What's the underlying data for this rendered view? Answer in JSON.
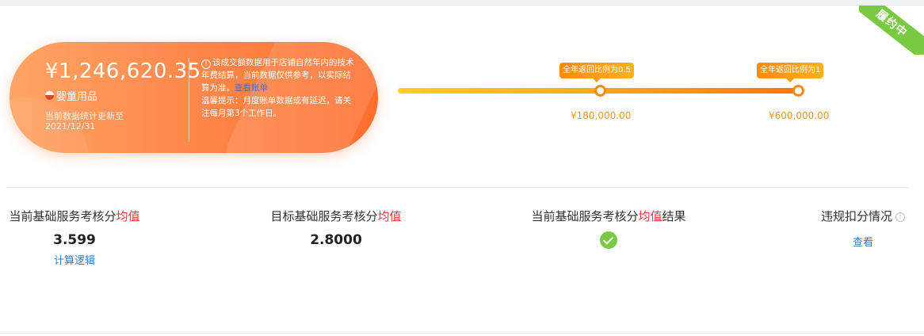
{
  "status_ribbon": {
    "label": "履约中",
    "color": "#7ac943"
  },
  "summary_card": {
    "amount": "¥1,246,620.35",
    "category": "婴童用品",
    "update_label": "当前数据统计更新至",
    "update_date": "2021/12/31",
    "notice_text_1": "该成交额数据用于店铺自然年内的技术年费结算，当前数据仅供参考，以实际结算为准。",
    "notice_link": "查看账单",
    "notice_text_2": "温馨提示：月度账单数据或有延迟，请关注每月第3个工作日。",
    "gradient_colors": [
      "#ffa466",
      "#ff6e2f"
    ]
  },
  "progress": {
    "milestones": [
      {
        "bubble": "全年返回比例为0.5",
        "amount": "¥180,000.00"
      },
      {
        "bubble": "全年返回比例为1",
        "amount": "¥600,000.00"
      }
    ],
    "track_colors": [
      "#ffd020",
      "#ff7410"
    ]
  },
  "stats": {
    "current_score": {
      "label_prefix": "当前基础服务考核分",
      "label_highlight": "均值",
      "value": "3.599",
      "link": "计算逻辑"
    },
    "target_score": {
      "label_prefix": "目标基础服务考核分",
      "label_highlight": "均值",
      "value": "2.8000"
    },
    "score_result": {
      "label_prefix": "当前基础服务考核分",
      "label_highlight": "均值",
      "label_suffix": "结果",
      "icon": "check-circle-icon"
    },
    "violation": {
      "label": "违规扣分情况",
      "link": "查看"
    }
  }
}
